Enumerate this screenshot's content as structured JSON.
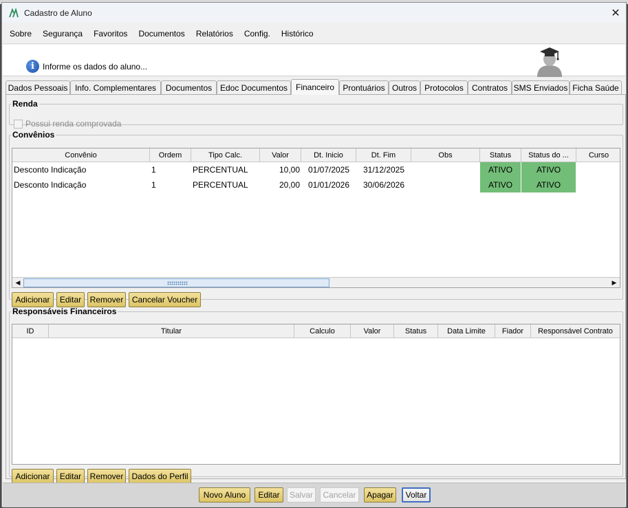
{
  "window": {
    "title": "Cadastro de Aluno",
    "close_glyph": "✕"
  },
  "menu": [
    "Sobre",
    "Segurança",
    "Favoritos",
    "Documentos",
    "Relatórios",
    "Config.",
    "Histórico"
  ],
  "banner": {
    "text": "Informe os dados do aluno..."
  },
  "tabs": [
    {
      "label": "Dados Pessoais"
    },
    {
      "label": "Info. Complementares"
    },
    {
      "label": "Documentos"
    },
    {
      "label": "Edoc Documentos"
    },
    {
      "label": "Financeiro",
      "active": true
    },
    {
      "label": "Prontuários"
    },
    {
      "label": "Outros"
    },
    {
      "label": "Protocolos"
    },
    {
      "label": "Contratos"
    },
    {
      "label": "SMS Enviados"
    },
    {
      "label": "Ficha Saúde"
    }
  ],
  "renda": {
    "legend": "Renda",
    "checkbox_label": "Possui renda comprovada",
    "checked": false
  },
  "convenios": {
    "legend": "Convênios",
    "columns": [
      "Convênio",
      "Ordem",
      "Tipo Calc.",
      "Valor",
      "Dt. Inicio",
      "Dt. Fim",
      "Obs",
      "Status",
      "Status do ...",
      "Curso"
    ],
    "rows": [
      [
        "Desconto Indicação",
        "1",
        "PERCENTUAL",
        "10,00",
        "01/07/2025",
        "31/12/2025",
        "",
        "ATIVO",
        "ATIVO",
        ""
      ],
      [
        "Desconto Indicação",
        "1",
        "PERCENTUAL",
        "20,00",
        "01/01/2026",
        "30/06/2026",
        "",
        "ATIVO",
        "ATIVO",
        ""
      ]
    ],
    "buttons": [
      "Adicionar",
      "Editar",
      "Remover",
      "Cancelar Voucher"
    ]
  },
  "responsaveis": {
    "legend": "Responsáveis Financeiros",
    "columns": [
      "ID",
      "Titular",
      "Calculo",
      "Valor",
      "Status",
      "Data Limite",
      "Fiador",
      "Responsável Contrato"
    ],
    "rows": [],
    "buttons": [
      "Adicionar",
      "Editar",
      "Remover",
      "Dados do Perfil"
    ]
  },
  "footer_buttons": [
    {
      "label": "Novo Aluno",
      "state": "enabled"
    },
    {
      "label": "Editar",
      "state": "enabled"
    },
    {
      "label": "Salvar",
      "state": "disabled"
    },
    {
      "label": "Cancelar",
      "state": "disabled"
    },
    {
      "label": "Apagar",
      "state": "enabled"
    },
    {
      "label": "Voltar",
      "state": "default"
    }
  ],
  "colors": {
    "status_green": "#72bd77",
    "button_gold": "#dcc465",
    "focus_blue": "#3f6ec2"
  }
}
